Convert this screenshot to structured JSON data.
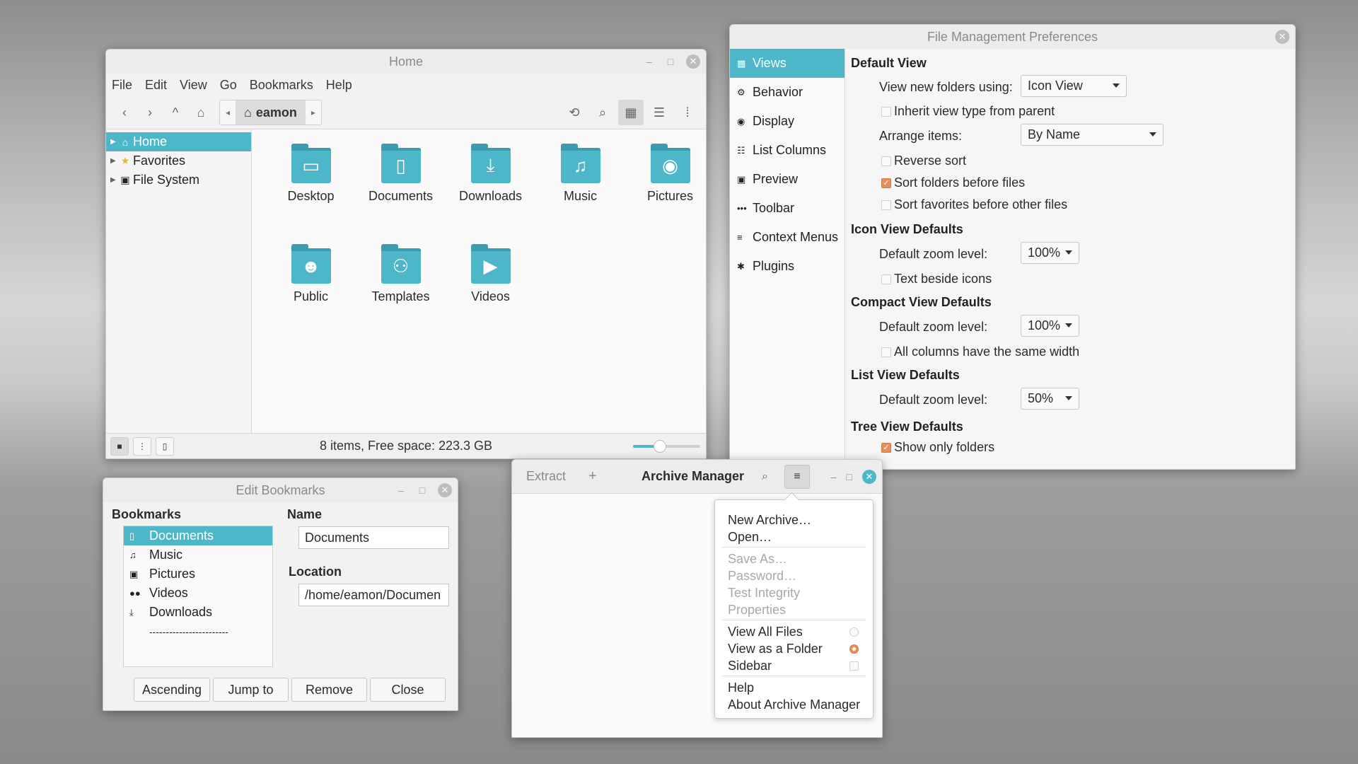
{
  "file_manager": {
    "title": "Home",
    "menu": [
      "File",
      "Edit",
      "View",
      "Go",
      "Bookmarks",
      "Help"
    ],
    "path_crumb": "eamon",
    "sidebar": [
      {
        "label": "Home",
        "icon": "home-icon"
      },
      {
        "label": "Favorites",
        "icon": "star-icon"
      },
      {
        "label": "File System",
        "icon": "drive-icon"
      }
    ],
    "folders": [
      {
        "label": "Desktop",
        "icon": "desktop-icon"
      },
      {
        "label": "Documents",
        "icon": "document-icon"
      },
      {
        "label": "Downloads",
        "icon": "download-icon"
      },
      {
        "label": "Music",
        "icon": "music-note-icon"
      },
      {
        "label": "Pictures",
        "icon": "camera-icon"
      },
      {
        "label": "Public",
        "icon": "person-icon"
      },
      {
        "label": "Templates",
        "icon": "template-icon"
      },
      {
        "label": "Videos",
        "icon": "video-camera-icon"
      }
    ],
    "status": "8 items, Free space: 223.3 GB",
    "zoom_fraction": 0.4,
    "accent_color": "#4db7c9"
  },
  "prefs": {
    "title": "File Management Preferences",
    "sidebar": [
      {
        "label": "Views",
        "icon": "grid-icon"
      },
      {
        "label": "Behavior",
        "icon": "gear-icon"
      },
      {
        "label": "Display",
        "icon": "eye-icon"
      },
      {
        "label": "List Columns",
        "icon": "list-icon"
      },
      {
        "label": "Preview",
        "icon": "image-icon"
      },
      {
        "label": "Toolbar",
        "icon": "dots-icon"
      },
      {
        "label": "Context Menus",
        "icon": "menu-icon"
      },
      {
        "label": "Plugins",
        "icon": "puzzle-icon"
      }
    ],
    "default_view": {
      "heading": "Default View",
      "view_new_label": "View new folders using:",
      "view_new_value": "Icon View",
      "inherit_label": "Inherit view type from parent",
      "arrange_label": "Arrange items:",
      "arrange_value": "By Name",
      "reverse_label": "Reverse sort",
      "folders_first_label": "Sort folders before files",
      "favorites_first_label": "Sort favorites before other files"
    },
    "icon_view": {
      "heading": "Icon View Defaults",
      "zoom_label": "Default zoom level:",
      "zoom_value": "100%",
      "text_beside_label": "Text beside icons"
    },
    "compact_view": {
      "heading": "Compact View Defaults",
      "zoom_label": "Default zoom level:",
      "zoom_value": "100%",
      "same_width_label": "All columns have the same width"
    },
    "list_view": {
      "heading": "List View Defaults",
      "zoom_label": "Default zoom level:",
      "zoom_value": "50%"
    },
    "tree_view": {
      "heading": "Tree View Defaults",
      "only_folders_label": "Show only folders"
    },
    "check_color": "#e5905c"
  },
  "bookmarks": {
    "title": "Edit Bookmarks",
    "list_heading": "Bookmarks",
    "items": [
      {
        "label": "Documents",
        "icon": "document-icon"
      },
      {
        "label": "Music",
        "icon": "music-note-icon"
      },
      {
        "label": "Pictures",
        "icon": "image-icon"
      },
      {
        "label": "Videos",
        "icon": "video-icon"
      },
      {
        "label": "Downloads",
        "icon": "download-icon"
      }
    ],
    "separator": "------------------------",
    "name_label": "Name",
    "name_value": "Documents",
    "location_label": "Location",
    "location_value": "/home/eamon/Documen",
    "buttons": {
      "ascending": "Ascending",
      "jump": "Jump to",
      "remove": "Remove",
      "close": "Close"
    }
  },
  "archive": {
    "title": "Archive Manager",
    "extract_label": "Extract",
    "add_label": "+",
    "menu": {
      "new_archive": "New Archive…",
      "open": "Open…",
      "save_as": "Save As…",
      "password": "Password…",
      "test_integrity": "Test Integrity",
      "properties": "Properties",
      "view_all": "View All Files",
      "view_folder": "View as a Folder",
      "sidebar": "Sidebar",
      "help": "Help",
      "about": "About Archive Manager"
    }
  }
}
